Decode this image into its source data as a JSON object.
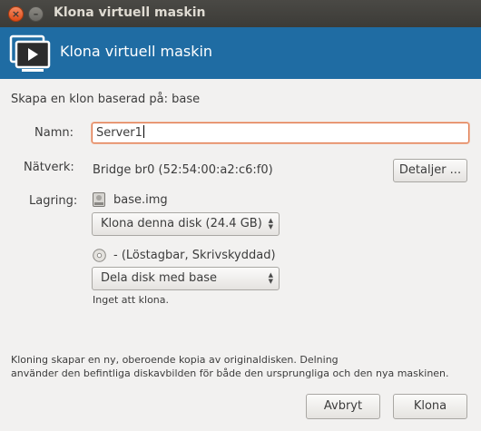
{
  "window": {
    "title": "Klona virtuell maskin",
    "close_glyph": "×",
    "minimize_glyph": "–"
  },
  "banner": {
    "title": "Klona virtuell maskin",
    "icon": "vm-monitor-icon",
    "color": "#1f6ca3"
  },
  "form": {
    "subtitle": "Skapa en klon baserad på: base",
    "name_label": "Namn:",
    "name_value": "Server1",
    "network_label": "Nätverk:",
    "network_value": "Bridge br0 (52:54:00:a2:c6:f0)",
    "details_button": "Detaljer ...",
    "storage_label": "Lagring:",
    "disks": [
      {
        "icon": "harddisk-icon",
        "name": "base.img",
        "action": "Klona denna disk (24.4 GB)",
        "note": ""
      },
      {
        "icon": "cdrom-icon",
        "name": "- (Löstagbar, Skrivskyddad)",
        "action": "Dela disk med base",
        "note": "Inget att klona."
      }
    ]
  },
  "footer": {
    "info_line1": "Kloning skapar en ny, oberoende kopia av originaldisken.  Delning",
    "info_line2": "använder den befintliga diskavbilden för både den ursprungliga och den nya maskinen.",
    "cancel_button": "Avbryt",
    "clone_button": "Klona"
  },
  "colors": {
    "accent": "#1f6ca3",
    "focus": "#e07a4f",
    "titlebar": "#3c3b37"
  }
}
